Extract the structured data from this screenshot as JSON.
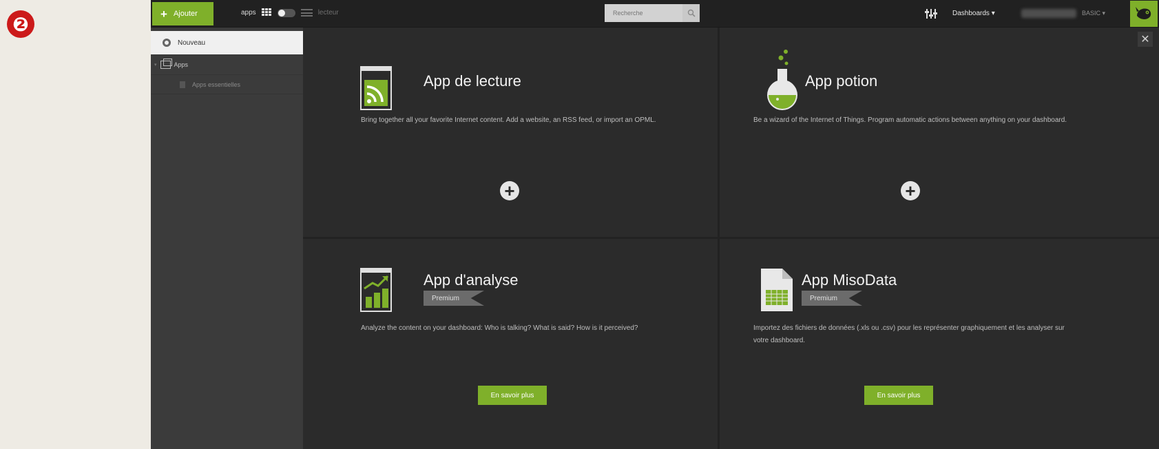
{
  "step_badge": "❷",
  "topbar": {
    "add_label": "Ajouter",
    "view_label": "apps",
    "reader_label": "lecteur",
    "search_placeholder": "Recherche",
    "dashboards_label": "Dashboards ▾",
    "user_label": "BASIC ▾"
  },
  "sidebar": {
    "new_label": "Nouveau",
    "apps_label": "Apps",
    "sub_label": "Apps essentielles"
  },
  "cards": [
    {
      "title": "App de lecture",
      "description": "Bring together all your favorite Internet content. Add a website, an RSS feed, or import an OPML.",
      "icon": "rss-window-icon"
    },
    {
      "title": "App potion",
      "description": "Be a wizard of the Internet of Things. Program automatic actions between anything on your dashboard.",
      "icon": "potion-flask-icon"
    },
    {
      "title": "App d'analyse",
      "badge": "Premium",
      "description": "Analyze the content on your dashboard: Who is talking? What is said? How is it perceived?",
      "button": "En savoir plus",
      "icon": "chart-window-icon"
    },
    {
      "title": "App MisoData",
      "badge": "Premium",
      "description": "Importez des fichiers de données (.xls ou .csv) pour les représenter graphiquement et les analyser sur votre dashboard.",
      "button": "En savoir plus",
      "icon": "spreadsheet-file-icon"
    }
  ],
  "colors": {
    "accent": "#7fb02a",
    "badge": "#cc1a1a",
    "background": "#2b2b2b"
  }
}
